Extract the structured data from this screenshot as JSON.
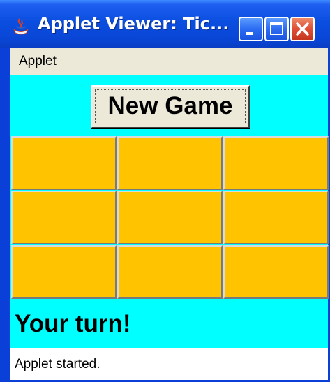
{
  "window": {
    "title": "Applet Viewer: Tic...",
    "controls": [
      "minimize-icon",
      "maximize-icon",
      "close-icon"
    ],
    "title_color": "#0a4ee0"
  },
  "menubar": {
    "items": [
      {
        "label": "Applet"
      }
    ]
  },
  "applet": {
    "background": "#00ffff",
    "new_game_label": "New Game",
    "cell_color": "#ffc300",
    "board": [
      [
        "",
        "",
        ""
      ],
      [
        "",
        "",
        ""
      ],
      [
        "",
        "",
        ""
      ]
    ],
    "turn_message": "Your turn!"
  },
  "statusbar": {
    "text": "Applet started."
  }
}
